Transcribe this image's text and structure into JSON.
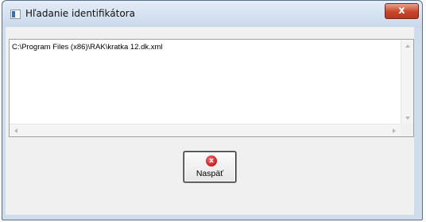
{
  "window": {
    "title": "Hľadanie identifikátora",
    "close_symbol": "x",
    "close_icon": "close-icon"
  },
  "text_field": {
    "value": "C:\\Program Files (x86)\\RAK\\kratka 12.dk.xml"
  },
  "back_button": {
    "label": "Naspäť",
    "icon": "cancel-icon",
    "icon_symbol": "x",
    "icon_color": "#d02020"
  },
  "colors": {
    "titlebar": "#cfdcec",
    "close_button": "#c7452a",
    "client_background": "#f0f0f0"
  }
}
